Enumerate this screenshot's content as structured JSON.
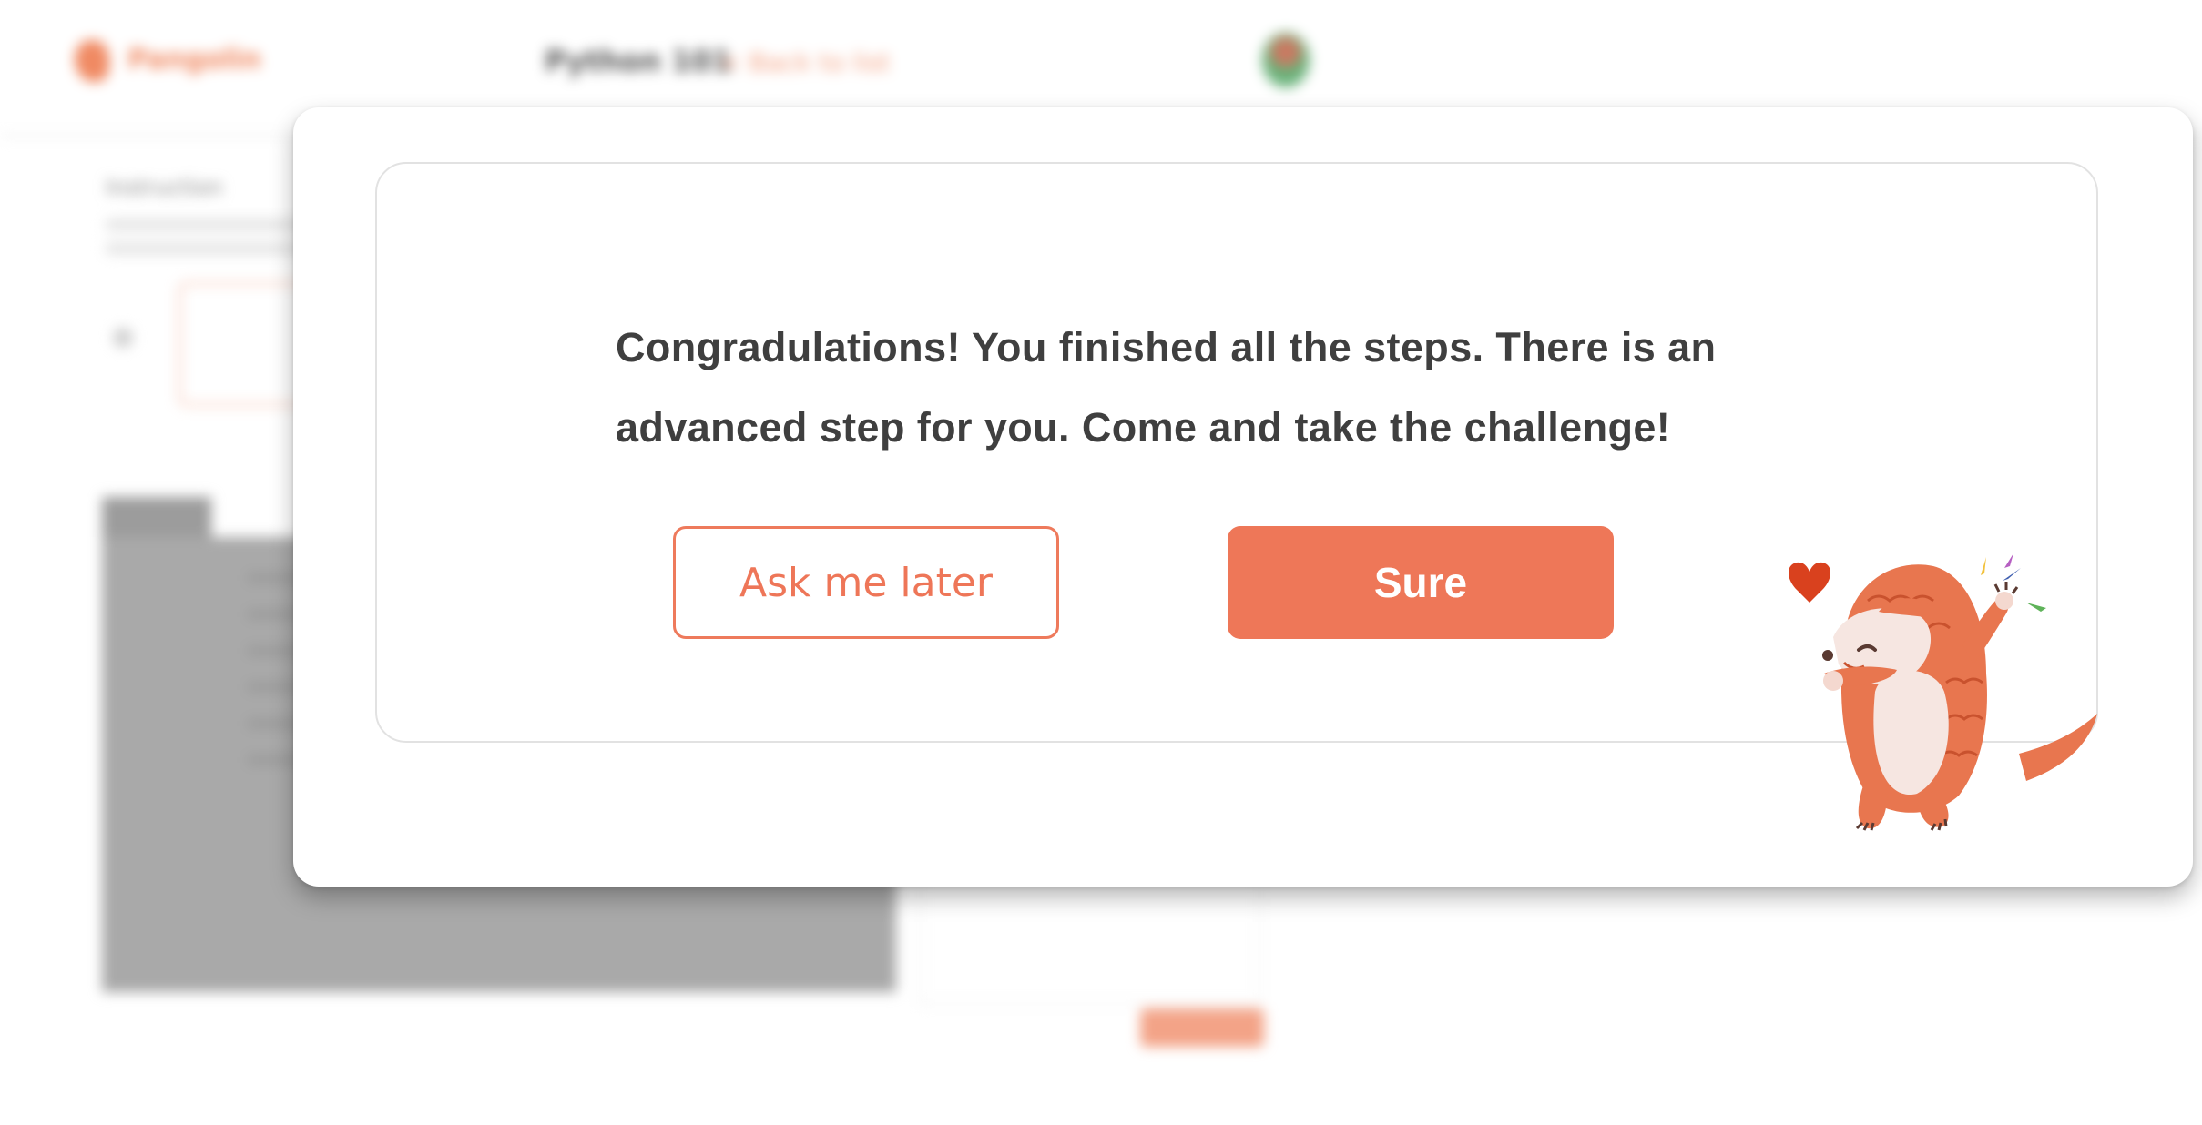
{
  "background_page": {
    "logo_text": "Pangolin",
    "course_title": "Python 101",
    "course_link": "< Back to list",
    "breadcrumb": "Instruction",
    "run_button_label": ""
  },
  "dialog": {
    "message": "Congradulations! You finished all the steps. There is an advanced step for you. Come and take the challenge!",
    "secondary_button": "Ask me later",
    "primary_button": "Sure"
  },
  "colors": {
    "accent": "#EE7758",
    "text": "#3F3F3F",
    "card_border": "#E2E2E2"
  },
  "icons": {
    "mascot": "pangolin-celebrating-illustration",
    "heart": "heart-icon"
  }
}
